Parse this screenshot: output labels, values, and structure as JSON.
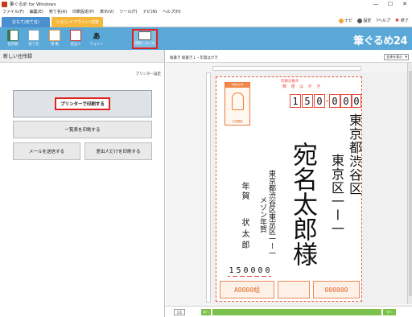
{
  "window": {
    "title": "筆ぐるめ for Windows"
  },
  "menu": [
    "ファイル(F)",
    "編集(E)",
    "宛て名(A)",
    "印刷設定(P)",
    "表示(V)",
    "ツール(T)",
    "ナビ(N)",
    "ヘルプ(H)"
  ],
  "tabs": {
    "tab1": "おもて(宛て名)",
    "tab2": "うら(レイアウト)へ切替"
  },
  "toplinks": {
    "navi": "ナビ",
    "settings": "設定",
    "help": "?ヘルプ",
    "exit": "終了"
  },
  "ribbon": {
    "buttons": [
      "住所録",
      "宛て名",
      "用 紙",
      "差出人",
      "フォント",
      "印刷・メール"
    ],
    "brand": "筆ぐるめ24"
  },
  "left": {
    "header": "新しい住所録",
    "print_settings": "プリンター設定",
    "buttons": {
      "printer": "プリンターで印刷する",
      "list": "一覧表を印刷する",
      "mail": "メールを送信する",
      "sender": "差出人だけを印刷する"
    }
  },
  "right": {
    "caption": "縦書き 縦書き１・年賀はがき",
    "zoom": "全体を表示",
    "page": "1/1",
    "nav_prev": "前へ",
    "nav_next": "次へ"
  },
  "card": {
    "printed_notice": "印刷対象外",
    "postcard_label": "郵 便 は が き",
    "zip": [
      "1",
      "5",
      "0",
      "0",
      "0",
      "0",
      "0"
    ],
    "address": [
      "東京都渋谷区東京区一一一"
    ],
    "addr_col1": "東京都渋谷区",
    "addr_col2": "東京区一ー一",
    "recipient": "宛名太郎様",
    "sender_address": "東京都渋谷区東京区一ー一",
    "sender_building": "メゾン年賀",
    "greeting": "年賀",
    "sender_name": "状太郎",
    "sender_zip": [
      "1",
      "5",
      "0",
      "0",
      "0",
      "0"
    ],
    "stamp_label": "年賀はがき",
    "stamp_footer": "日本郵便",
    "strip": [
      "A0000組",
      "000000"
    ]
  }
}
